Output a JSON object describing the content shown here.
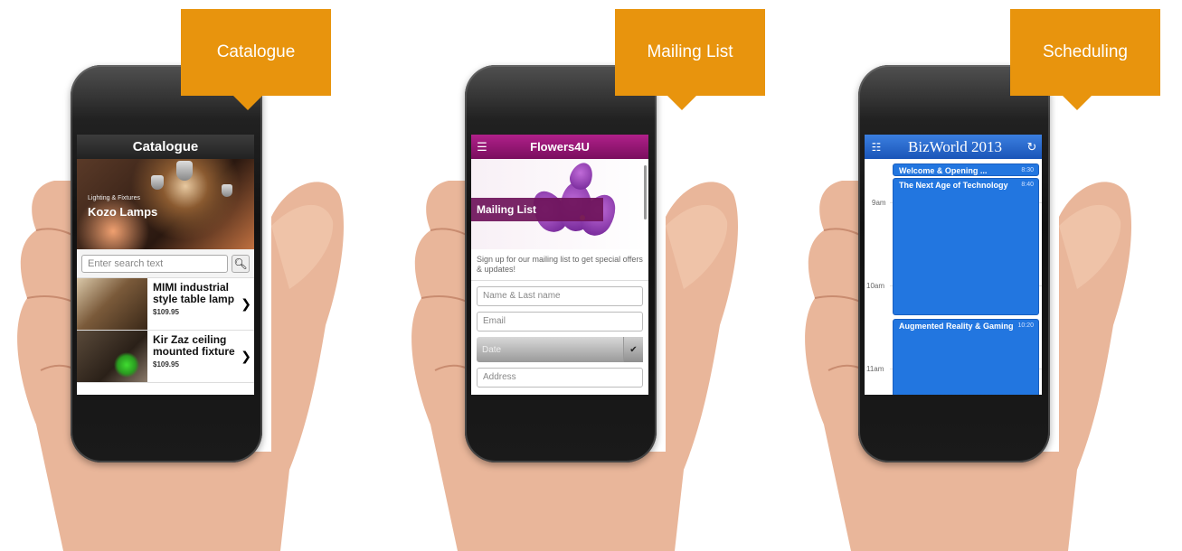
{
  "panels": [
    {
      "tag": "Catalogue",
      "screen": {
        "header_title": "Catalogue",
        "hero_subtitle": "Lighting & Fixtures",
        "hero_title": "Kozo Lamps",
        "search_placeholder": "Enter search text",
        "items": [
          {
            "name": "MIMI industrial style table lamp",
            "price": "$109.95"
          },
          {
            "name": "Kir Zaz ceiling mounted fixture",
            "price": "$109.95"
          }
        ]
      }
    },
    {
      "tag": "Mailing List",
      "screen": {
        "header_title": "Flowers4U",
        "banner": "Mailing List",
        "intro": "Sign up for our mailing list to get special offers & updates!",
        "fields": {
          "name_placeholder": "Name & Last name",
          "email_placeholder": "Email",
          "date_label": "Date",
          "address_placeholder": "Address"
        }
      }
    },
    {
      "tag": "Scheduling",
      "screen": {
        "header_title": "BizWorld 2013",
        "times": [
          "9am",
          "10am",
          "11am"
        ],
        "events": [
          {
            "title": "Welcome & Opening ...",
            "time": "8:30"
          },
          {
            "title": "The Next Age of Technology",
            "time": "8:40"
          },
          {
            "title": "Augmented Reality & Gaming",
            "time": "10:20"
          }
        ]
      }
    }
  ],
  "colors": {
    "tag": "#e8940d",
    "catalogue_header": "#2e2e2e",
    "flowers_header": "#9b1a7a",
    "biz_header": "#2a6ad0",
    "event": "#2276e0"
  }
}
